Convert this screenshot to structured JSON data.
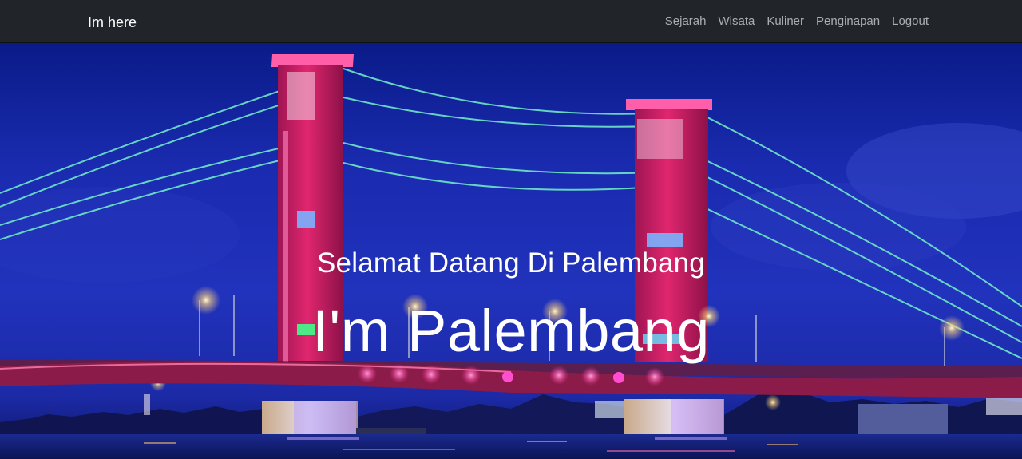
{
  "navbar": {
    "brand": "Im here",
    "links": [
      {
        "label": "Sejarah"
      },
      {
        "label": "Wisata"
      },
      {
        "label": "Kuliner"
      },
      {
        "label": "Penginapan"
      },
      {
        "label": "Logout"
      }
    ]
  },
  "hero": {
    "tagline": "Selamat Datang Di Palembang",
    "headline": "I'm Palembang",
    "image": "ampera-bridge-night-photo"
  },
  "colors": {
    "navbar_bg": "#212529",
    "sky": "#1a2bb0",
    "tower": "#e0266e",
    "cable": "#6fe7c8"
  }
}
